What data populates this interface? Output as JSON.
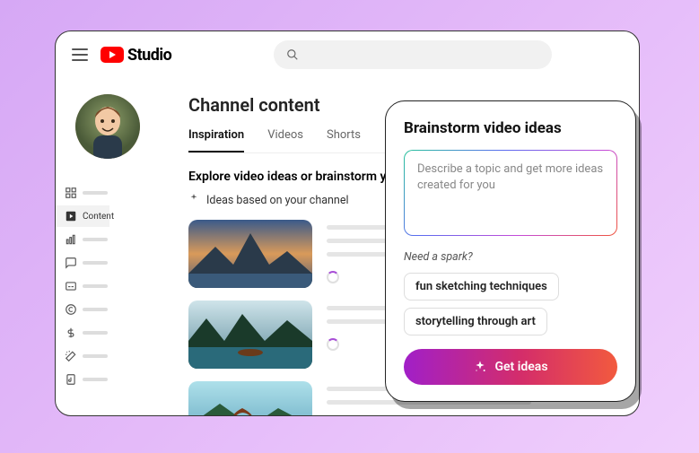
{
  "header": {
    "product": "Studio"
  },
  "sidebar": {
    "active_label": "Content"
  },
  "main": {
    "title": "Channel content",
    "tabs": [
      {
        "label": "Inspiration",
        "active": true
      },
      {
        "label": "Videos",
        "active": false
      },
      {
        "label": "Shorts",
        "active": false
      }
    ],
    "section_heading": "Explore video ideas or brainstorm your",
    "subline": "Ideas based on your channel"
  },
  "card": {
    "title": "Brainstorm video ideas",
    "placeholder": "Describe a topic and get more ideas created for you",
    "hint": "Need a spark?",
    "chips": [
      "fun sketching techniques",
      "storytelling through art"
    ],
    "cta": "Get ideas"
  }
}
